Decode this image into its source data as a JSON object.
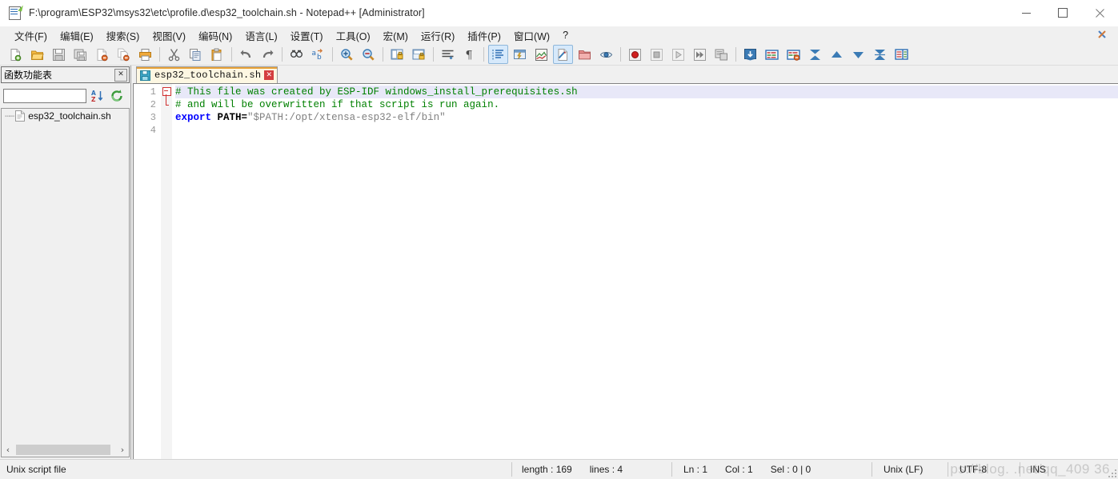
{
  "window": {
    "title": "F:\\program\\ESP32\\msys32\\etc\\profile.d\\esp32_toolchain.sh - Notepad++ [Administrator]",
    "minimize_label": "−",
    "maximize_label": "❐",
    "close_label": "✕"
  },
  "menu": {
    "items": [
      {
        "label": "文件(F)",
        "name": "menu-file"
      },
      {
        "label": "编辑(E)",
        "name": "menu-edit"
      },
      {
        "label": "搜索(S)",
        "name": "menu-search"
      },
      {
        "label": "视图(V)",
        "name": "menu-view"
      },
      {
        "label": "编码(N)",
        "name": "menu-encoding"
      },
      {
        "label": "语言(L)",
        "name": "menu-language"
      },
      {
        "label": "设置(T)",
        "name": "menu-settings"
      },
      {
        "label": "工具(O)",
        "name": "menu-tools"
      },
      {
        "label": "宏(M)",
        "name": "menu-macro"
      },
      {
        "label": "运行(R)",
        "name": "menu-run"
      },
      {
        "label": "插件(P)",
        "name": "menu-plugins"
      },
      {
        "label": "窗口(W)",
        "name": "menu-window"
      },
      {
        "label": "?",
        "name": "menu-help"
      }
    ],
    "close_document_label": "✕"
  },
  "toolbar": {
    "buttons": [
      "new-file-icon",
      "open-file-icon",
      "save-icon",
      "save-all-icon",
      "close-file-icon",
      "close-all-icon",
      "print-icon",
      "cut-icon",
      "copy-icon",
      "paste-icon",
      "undo-icon",
      "redo-icon",
      "find-icon",
      "replace-icon",
      "zoom-in-icon",
      "zoom-out-icon",
      "sync-vertical-scroll-icon",
      "sync-horizontal-scroll-icon",
      "word-wrap-icon",
      "show-all-characters-icon",
      "indent-guide-icon",
      "user-defined-dialog-icon",
      "document-map-icon",
      "function-list-icon",
      "folder-as-workspace-icon",
      "monitoring-icon",
      "record-macro-icon",
      "stop-recording-icon",
      "play-macro-icon",
      "run-macro-multiple-icon",
      "save-macro-icon",
      "run-icon",
      "show-nonprint-icon",
      "remove-nonprint-icon",
      "collapse-all-icon",
      "collapse-level-icon",
      "expand-level-icon",
      "expand-all-icon",
      "split-view-icon"
    ]
  },
  "function_panel": {
    "title": "函数功能表",
    "close_label": "✕",
    "search_value": "",
    "search_placeholder": "",
    "sort_button_name": "sort-az-button",
    "reload_button_name": "reload-button",
    "tree_items": [
      {
        "label": "esp32_toolchain.sh",
        "name": "function-tree-item"
      }
    ],
    "hscroll_left_label": "‹",
    "hscroll_right_label": "›"
  },
  "tabs": [
    {
      "label": "esp32_toolchain.sh",
      "close_label": "✕",
      "active": true
    }
  ],
  "editor": {
    "line_numbers": [
      "1",
      "2",
      "3",
      "4"
    ],
    "lines": [
      {
        "current": true,
        "tokens": [
          {
            "text": "# This file was created by ESP-IDF windows_install_prerequisites.sh",
            "cls": "cm"
          }
        ]
      },
      {
        "current": false,
        "tokens": [
          {
            "text": "# and will be overwritten if that script is run again.",
            "cls": "cm"
          }
        ]
      },
      {
        "current": false,
        "tokens": [
          {
            "text": "export",
            "cls": "kw"
          },
          {
            "text": " ",
            "cls": "id"
          },
          {
            "text": "PATH=",
            "cls": "id"
          },
          {
            "text": "\"$PATH:/opt/xtensa-esp32-elf/bin\"",
            "cls": "str"
          }
        ]
      },
      {
        "current": false,
        "tokens": []
      }
    ]
  },
  "statusbar": {
    "file_type": "Unix script file",
    "length_label": "length : 169",
    "lines_label": "lines : 4",
    "ln_label": "Ln : 1",
    "col_label": "Col : 1",
    "sel_label": "Sel : 0 | 0",
    "eol": "Unix (LF)",
    "encoding": "UTF-8",
    "insert_mode": "INS"
  },
  "watermark": "ps://blog.    .net/qq_409    36"
}
